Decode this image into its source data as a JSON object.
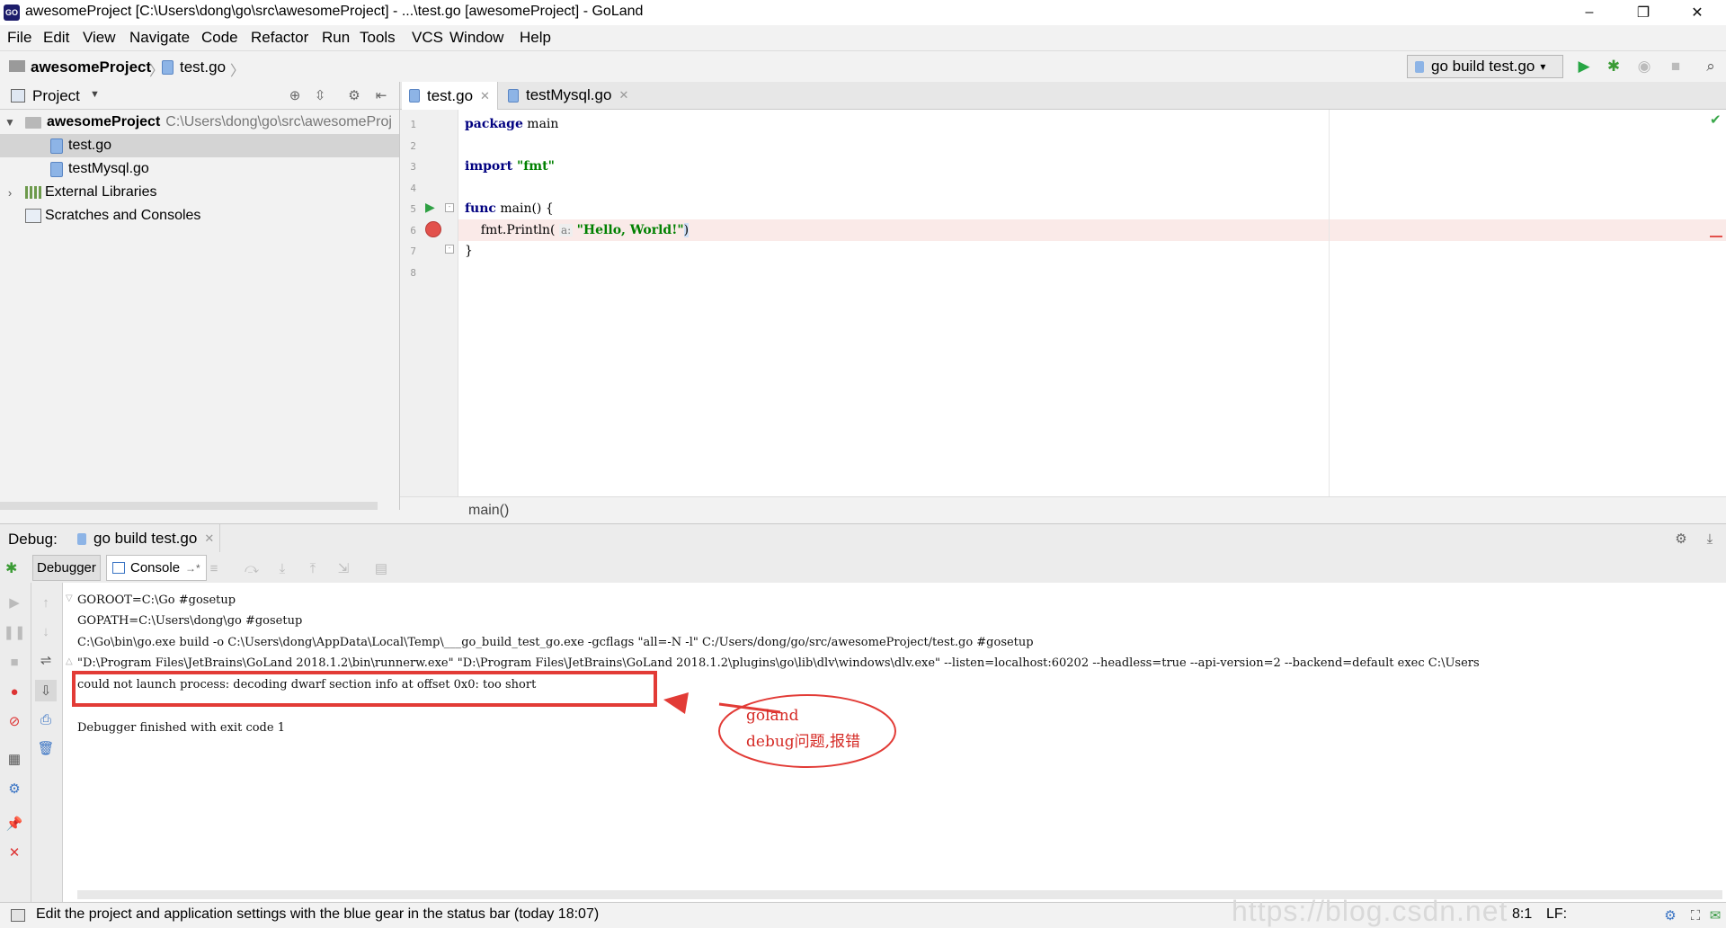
{
  "window": {
    "app_icon": "GO",
    "title": "awesomeProject [C:\\Users\\dong\\go\\src\\awesomeProject] - ...\\test.go [awesomeProject] - GoLand",
    "minimize": "–",
    "maximize": "❐",
    "close": "✕"
  },
  "menu": [
    "File",
    "Edit",
    "View",
    "Navigate",
    "Code",
    "Refactor",
    "Run",
    "Tools",
    "VCS",
    "Window",
    "Help"
  ],
  "navbar": {
    "project": "awesomeProject",
    "file": "test.go",
    "run_config": "go build test.go"
  },
  "project_panel": {
    "title": "Project",
    "root_name": "awesomeProject",
    "root_path": "C:\\Users\\dong\\go\\src\\awesomeProj",
    "files": [
      "test.go",
      "testMysql.go"
    ],
    "external": "External Libraries",
    "scratches": "Scratches and Consoles"
  },
  "editor": {
    "tabs": [
      "test.go",
      "testMysql.go"
    ],
    "line_numbers": [
      "1",
      "2",
      "3",
      "4",
      "5",
      "6",
      "7",
      "8"
    ],
    "code": {
      "l1_kw": "package",
      "l1_rest": " main",
      "l3_kw": "import",
      "l3_str": " \"fmt\"",
      "l5_kw": "func",
      "l5_rest": " main() {",
      "l6_pre": "    fmt.Println(",
      "l6_hint": "a:",
      "l6_str": "\"Hello, World!\"",
      "l6_post": ")",
      "l7": "}"
    },
    "breadcrumb": "main()"
  },
  "debug": {
    "label": "Debug:",
    "session_tab": "go build test.go",
    "tab_debugger": "Debugger",
    "tab_console": "Console",
    "console_lines": [
      "GOROOT=C:\\Go #gosetup",
      "GOPATH=C:\\Users\\dong\\go #gosetup",
      "C:\\Go\\bin\\go.exe build -o C:\\Users\\dong\\AppData\\Local\\Temp\\___go_build_test_go.exe -gcflags \"all=-N -l\" C:/Users/dong/go/src/awesomeProject/test.go #gosetup",
      "\"D:\\Program Files\\JetBrains\\GoLand 2018.1.2\\bin\\runnerw.exe\" \"D:\\Program Files\\JetBrains\\GoLand 2018.1.2\\plugins\\go\\lib\\dlv\\windows\\dlv.exe\" --listen=localhost:60202 --headless=true --api-version=2 --backend=default exec C:\\Users"
    ],
    "error_line": "could not launch process: decoding dwarf section info at offset 0x0: too short",
    "finish_line": "Debugger finished with exit code 1"
  },
  "annotation": {
    "line1": "goland",
    "line2": "debug问题,报错"
  },
  "status": {
    "message": "Edit the project and application settings with the blue gear in the status bar (today 18:07)",
    "position": "8:1",
    "line_sep": "LF:",
    "watermark": "https://blog.csdn.net"
  }
}
